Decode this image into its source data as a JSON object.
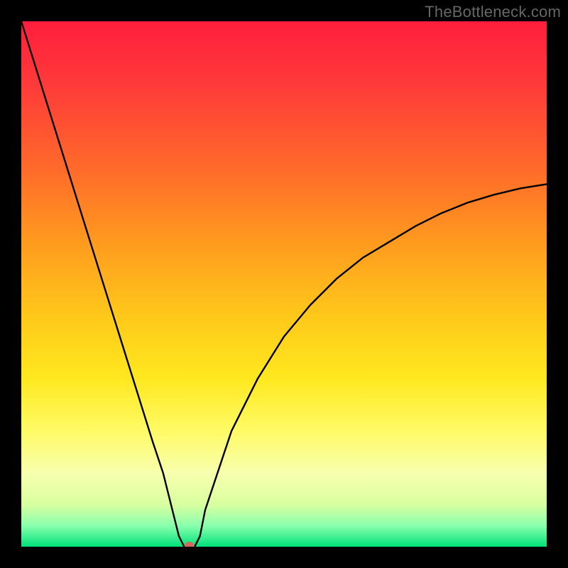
{
  "watermark": "TheBottleneck.com",
  "chart_data": {
    "type": "line",
    "title": "",
    "xlabel": "",
    "ylabel": "",
    "xlim": [
      0,
      100
    ],
    "ylim": [
      0,
      100
    ],
    "grid": false,
    "legend": false,
    "series": [
      {
        "name": "curve",
        "x": [
          0,
          5,
          10,
          15,
          20,
          25,
          27,
          30,
          31,
          33,
          34,
          35,
          40,
          45,
          50,
          55,
          60,
          65,
          70,
          75,
          80,
          85,
          90,
          95,
          100
        ],
        "values": [
          100,
          84,
          68,
          52,
          36,
          20,
          14,
          2,
          0,
          0,
          2,
          7,
          22,
          32,
          40,
          46,
          51,
          55,
          58,
          61,
          63.5,
          65.5,
          67,
          68.2,
          69
        ]
      }
    ],
    "marker": {
      "x": 32,
      "y": 0,
      "color": "#d26a5c",
      "radius_px": 7
    },
    "colors": {
      "curve": "#000000",
      "background_top": "#ff1e3c",
      "background_bottom": "#00e27a",
      "frame": "#000000",
      "watermark": "#666666"
    }
  }
}
